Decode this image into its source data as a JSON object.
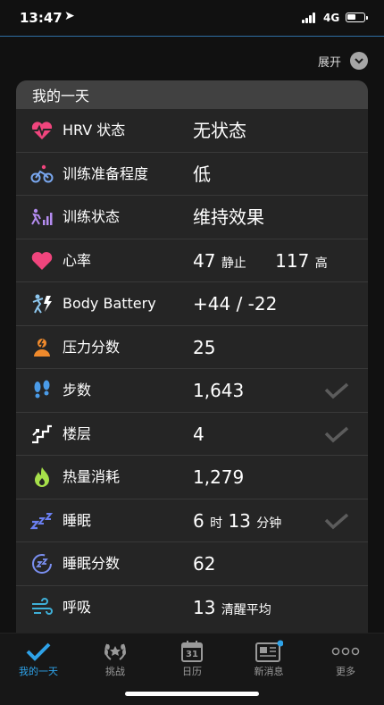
{
  "status": {
    "time": "13:47",
    "network": "4G"
  },
  "expand": {
    "label": "展开"
  },
  "card": {
    "title": "我的一天",
    "rows": [
      {
        "label": "HRV 状态",
        "value": "无状态"
      },
      {
        "label": "训练准备程度",
        "value": "低"
      },
      {
        "label": "训练状态",
        "value": "维持效果"
      },
      {
        "label": "心率",
        "resting_value": "47",
        "resting_unit": "静止",
        "high_value": "117",
        "high_unit": "高"
      },
      {
        "label": "Body Battery",
        "value": "+44 / -22"
      },
      {
        "label": "压力分数",
        "value": "25"
      },
      {
        "label": "步数",
        "value": "1,643",
        "checked": true
      },
      {
        "label": "楼层",
        "value": "4",
        "checked": true
      },
      {
        "label": "热量消耗",
        "value": "1,279"
      },
      {
        "label": "睡眠",
        "hours": "6",
        "hours_unit": "时",
        "minutes": "13",
        "minutes_unit": "分钟",
        "checked": true
      },
      {
        "label": "睡眠分数",
        "value": "62"
      },
      {
        "label": "呼吸",
        "value": "13",
        "unit": "清醒平均"
      }
    ]
  },
  "tabs": [
    {
      "label": "我的一天",
      "icon": "checkmark-icon",
      "active": true
    },
    {
      "label": "挑战",
      "icon": "laurel-icon"
    },
    {
      "label": "日历",
      "icon": "calendar-icon",
      "date": "31"
    },
    {
      "label": "新消息",
      "icon": "news-icon",
      "badge": true
    },
    {
      "label": "更多",
      "icon": "more-dots-icon"
    }
  ],
  "colors": {
    "accent": "#2ea2e8",
    "heart": "#f0457d",
    "stress": "#f08a2c",
    "steps": "#4a9be8",
    "calories": "#a6e04a",
    "sleep": "#6a7ff0",
    "breath": "#3fb0d8"
  }
}
